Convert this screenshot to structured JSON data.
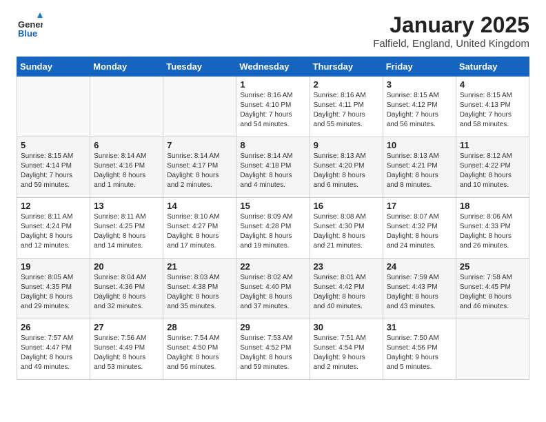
{
  "logo": {
    "general": "General",
    "blue": "Blue"
  },
  "title": "January 2025",
  "location": "Falfield, England, United Kingdom",
  "weekdays": [
    "Sunday",
    "Monday",
    "Tuesday",
    "Wednesday",
    "Thursday",
    "Friday",
    "Saturday"
  ],
  "weeks": [
    [
      {
        "day": "",
        "info": ""
      },
      {
        "day": "",
        "info": ""
      },
      {
        "day": "",
        "info": ""
      },
      {
        "day": "1",
        "info": "Sunrise: 8:16 AM\nSunset: 4:10 PM\nDaylight: 7 hours\nand 54 minutes."
      },
      {
        "day": "2",
        "info": "Sunrise: 8:16 AM\nSunset: 4:11 PM\nDaylight: 7 hours\nand 55 minutes."
      },
      {
        "day": "3",
        "info": "Sunrise: 8:15 AM\nSunset: 4:12 PM\nDaylight: 7 hours\nand 56 minutes."
      },
      {
        "day": "4",
        "info": "Sunrise: 8:15 AM\nSunset: 4:13 PM\nDaylight: 7 hours\nand 58 minutes."
      }
    ],
    [
      {
        "day": "5",
        "info": "Sunrise: 8:15 AM\nSunset: 4:14 PM\nDaylight: 7 hours\nand 59 minutes."
      },
      {
        "day": "6",
        "info": "Sunrise: 8:14 AM\nSunset: 4:16 PM\nDaylight: 8 hours\nand 1 minute."
      },
      {
        "day": "7",
        "info": "Sunrise: 8:14 AM\nSunset: 4:17 PM\nDaylight: 8 hours\nand 2 minutes."
      },
      {
        "day": "8",
        "info": "Sunrise: 8:14 AM\nSunset: 4:18 PM\nDaylight: 8 hours\nand 4 minutes."
      },
      {
        "day": "9",
        "info": "Sunrise: 8:13 AM\nSunset: 4:20 PM\nDaylight: 8 hours\nand 6 minutes."
      },
      {
        "day": "10",
        "info": "Sunrise: 8:13 AM\nSunset: 4:21 PM\nDaylight: 8 hours\nand 8 minutes."
      },
      {
        "day": "11",
        "info": "Sunrise: 8:12 AM\nSunset: 4:22 PM\nDaylight: 8 hours\nand 10 minutes."
      }
    ],
    [
      {
        "day": "12",
        "info": "Sunrise: 8:11 AM\nSunset: 4:24 PM\nDaylight: 8 hours\nand 12 minutes."
      },
      {
        "day": "13",
        "info": "Sunrise: 8:11 AM\nSunset: 4:25 PM\nDaylight: 8 hours\nand 14 minutes."
      },
      {
        "day": "14",
        "info": "Sunrise: 8:10 AM\nSunset: 4:27 PM\nDaylight: 8 hours\nand 17 minutes."
      },
      {
        "day": "15",
        "info": "Sunrise: 8:09 AM\nSunset: 4:28 PM\nDaylight: 8 hours\nand 19 minutes."
      },
      {
        "day": "16",
        "info": "Sunrise: 8:08 AM\nSunset: 4:30 PM\nDaylight: 8 hours\nand 21 minutes."
      },
      {
        "day": "17",
        "info": "Sunrise: 8:07 AM\nSunset: 4:32 PM\nDaylight: 8 hours\nand 24 minutes."
      },
      {
        "day": "18",
        "info": "Sunrise: 8:06 AM\nSunset: 4:33 PM\nDaylight: 8 hours\nand 26 minutes."
      }
    ],
    [
      {
        "day": "19",
        "info": "Sunrise: 8:05 AM\nSunset: 4:35 PM\nDaylight: 8 hours\nand 29 minutes."
      },
      {
        "day": "20",
        "info": "Sunrise: 8:04 AM\nSunset: 4:36 PM\nDaylight: 8 hours\nand 32 minutes."
      },
      {
        "day": "21",
        "info": "Sunrise: 8:03 AM\nSunset: 4:38 PM\nDaylight: 8 hours\nand 35 minutes."
      },
      {
        "day": "22",
        "info": "Sunrise: 8:02 AM\nSunset: 4:40 PM\nDaylight: 8 hours\nand 37 minutes."
      },
      {
        "day": "23",
        "info": "Sunrise: 8:01 AM\nSunset: 4:42 PM\nDaylight: 8 hours\nand 40 minutes."
      },
      {
        "day": "24",
        "info": "Sunrise: 7:59 AM\nSunset: 4:43 PM\nDaylight: 8 hours\nand 43 minutes."
      },
      {
        "day": "25",
        "info": "Sunrise: 7:58 AM\nSunset: 4:45 PM\nDaylight: 8 hours\nand 46 minutes."
      }
    ],
    [
      {
        "day": "26",
        "info": "Sunrise: 7:57 AM\nSunset: 4:47 PM\nDaylight: 8 hours\nand 49 minutes."
      },
      {
        "day": "27",
        "info": "Sunrise: 7:56 AM\nSunset: 4:49 PM\nDaylight: 8 hours\nand 53 minutes."
      },
      {
        "day": "28",
        "info": "Sunrise: 7:54 AM\nSunset: 4:50 PM\nDaylight: 8 hours\nand 56 minutes."
      },
      {
        "day": "29",
        "info": "Sunrise: 7:53 AM\nSunset: 4:52 PM\nDaylight: 8 hours\nand 59 minutes."
      },
      {
        "day": "30",
        "info": "Sunrise: 7:51 AM\nSunset: 4:54 PM\nDaylight: 9 hours\nand 2 minutes."
      },
      {
        "day": "31",
        "info": "Sunrise: 7:50 AM\nSunset: 4:56 PM\nDaylight: 9 hours\nand 5 minutes."
      },
      {
        "day": "",
        "info": ""
      }
    ]
  ]
}
